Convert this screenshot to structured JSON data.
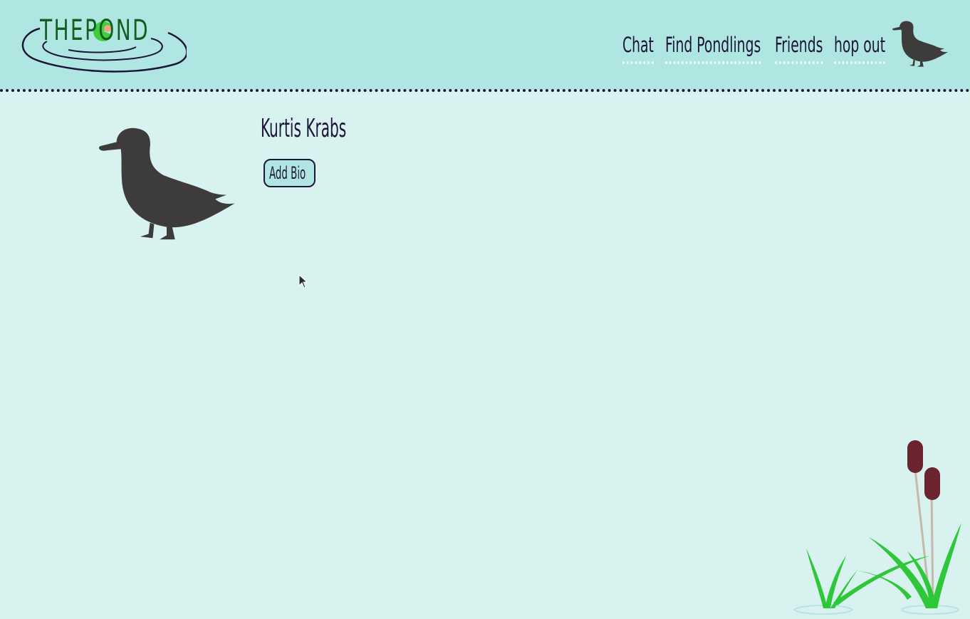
{
  "header": {
    "logo_text": "THEPOND",
    "nav": [
      {
        "label": "Chat"
      },
      {
        "label": "Find Pondlings"
      },
      {
        "label": "Friends"
      },
      {
        "label": "hop out"
      }
    ],
    "avatar_icon": "duck-icon"
  },
  "profile": {
    "name": "Kurtis Krabs",
    "add_bio_label": "Add Bio",
    "avatar_icon": "duck-icon"
  },
  "colors": {
    "header_bg": "#b0e6e1",
    "page_bg": "#d8f2f0",
    "text": "#1a1638",
    "duck": "#3d3b3b",
    "logo_green": "#135f23",
    "lily_pad": "#3fcf3a",
    "grass": "#2ec73a",
    "cattail": "#6b2330"
  }
}
